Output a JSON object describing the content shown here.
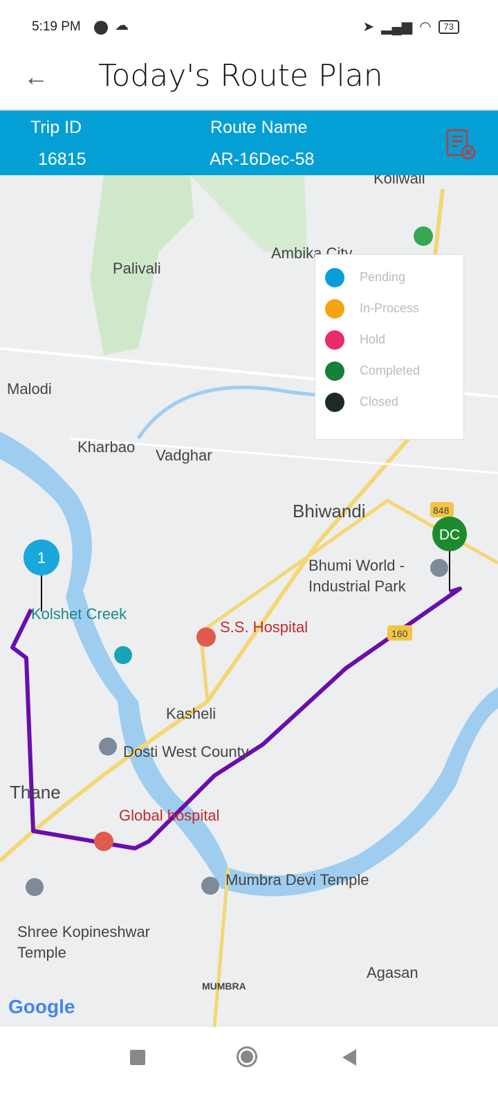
{
  "status_bar": {
    "time": "5:19 PM",
    "battery": "73"
  },
  "header": {
    "title": "Today's Route Plan"
  },
  "trip": {
    "trip_id_label": "Trip ID",
    "trip_id": "16815",
    "route_name_label": "Route Name",
    "route_name": "AR-16Dec-58"
  },
  "legend": [
    {
      "label": "Pending",
      "color": "#0a9ed9"
    },
    {
      "label": "In-Process",
      "color": "#f5a40f"
    },
    {
      "label": "Hold",
      "color": "#ea2a6b"
    },
    {
      "label": "Completed",
      "color": "#168039"
    },
    {
      "label": "Closed",
      "color": "#1e2a22"
    }
  ],
  "map": {
    "labels": {
      "koliwali": "Koliwali",
      "ambika": "Ambika City",
      "palivali": "Palivali",
      "malodi": "Malodi",
      "kharbao": "Kharbao",
      "vadghar": "Vadghar",
      "bhiwandi": "Bhiwandi",
      "bhumi1": "Bhumi World -",
      "bhumi2": "Industrial Park",
      "kolshet": "Kolshet Creek",
      "ss": "S.S. Hospital",
      "kasheli": "Kasheli",
      "dosti": "Dosti West County",
      "thane": "Thane",
      "global": "Global hospital",
      "mumbradevi": "Mumbra Devi Temple",
      "shree1": "Shree Kopineshwar",
      "shree2": "Temple",
      "agasan": "Agasan",
      "mumbra": "MUMBRA",
      "road848": "848",
      "road160": "160",
      "google": "Google"
    },
    "markers": {
      "stop1": "1",
      "dc": "DC"
    },
    "route_color": "#6a0dad"
  }
}
